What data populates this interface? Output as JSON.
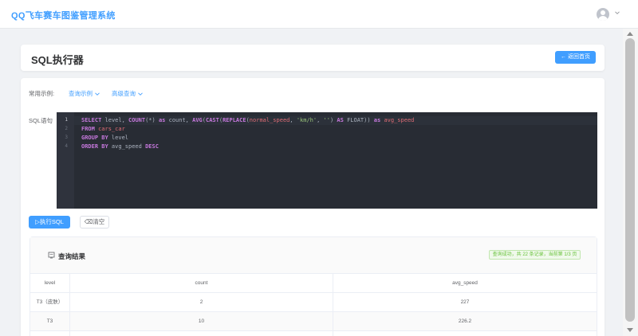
{
  "app": {
    "title": "QQ飞车赛车图鉴管理系统"
  },
  "header": {
    "page_title": "SQL执行器",
    "back_label": "← 返回首页"
  },
  "examples": {
    "label": "常用示例:",
    "query_examples": "查询示例",
    "advanced_query": "高级查询"
  },
  "editor": {
    "label": "SQL语句",
    "line_numbers": [
      "1",
      "2",
      "3",
      "4"
    ],
    "lines": [
      [
        {
          "t": "SELECT",
          "c": "kw"
        },
        {
          "t": " level, ",
          "c": ""
        },
        {
          "t": "COUNT",
          "c": "kw"
        },
        {
          "t": "(*) ",
          "c": ""
        },
        {
          "t": "as",
          "c": "kw"
        },
        {
          "t": " count, ",
          "c": ""
        },
        {
          "t": "AVG",
          "c": "kw"
        },
        {
          "t": "(",
          "c": ""
        },
        {
          "t": "CAST",
          "c": "kw"
        },
        {
          "t": "(",
          "c": ""
        },
        {
          "t": "REPLACE",
          "c": "kw"
        },
        {
          "t": "(",
          "c": ""
        },
        {
          "t": "normal_speed",
          "c": "tb"
        },
        {
          "t": ", ",
          "c": ""
        },
        {
          "t": "'km/h'",
          "c": "str"
        },
        {
          "t": ", ",
          "c": ""
        },
        {
          "t": "''",
          "c": "str"
        },
        {
          "t": ") ",
          "c": ""
        },
        {
          "t": "AS",
          "c": "kw"
        },
        {
          "t": " FLOAT)) ",
          "c": ""
        },
        {
          "t": "as",
          "c": "kw"
        },
        {
          "t": " ",
          "c": ""
        },
        {
          "t": "avg_speed",
          "c": "tb"
        }
      ],
      [
        {
          "t": "FROM",
          "c": "kw"
        },
        {
          "t": " ",
          "c": ""
        },
        {
          "t": "cars_car",
          "c": "tb"
        }
      ],
      [
        {
          "t": "GROUP BY",
          "c": "kw"
        },
        {
          "t": " level",
          "c": ""
        }
      ],
      [
        {
          "t": "ORDER BY",
          "c": "kw"
        },
        {
          "t": " avg_speed ",
          "c": ""
        },
        {
          "t": "DESC",
          "c": "kw"
        }
      ]
    ]
  },
  "actions": {
    "run_label": "▷执行SQL",
    "clear_label": "⌫清空"
  },
  "result": {
    "title": "查询结果",
    "status": "查询成功，共 22 条记录，当前第 1/3 页",
    "columns": [
      "level",
      "count",
      "avg_speed"
    ],
    "rows": [
      [
        "T3（皮肤）",
        "2",
        "227"
      ],
      [
        "T3",
        "10",
        "226.2"
      ]
    ]
  },
  "colors": {
    "primary": "#409eff",
    "success": "#67c23a",
    "editor_bg": "#282c34"
  },
  "icons": [
    "user-avatar-icon",
    "chevron-down-icon",
    "document-icon",
    "play-icon",
    "clear-icon"
  ]
}
